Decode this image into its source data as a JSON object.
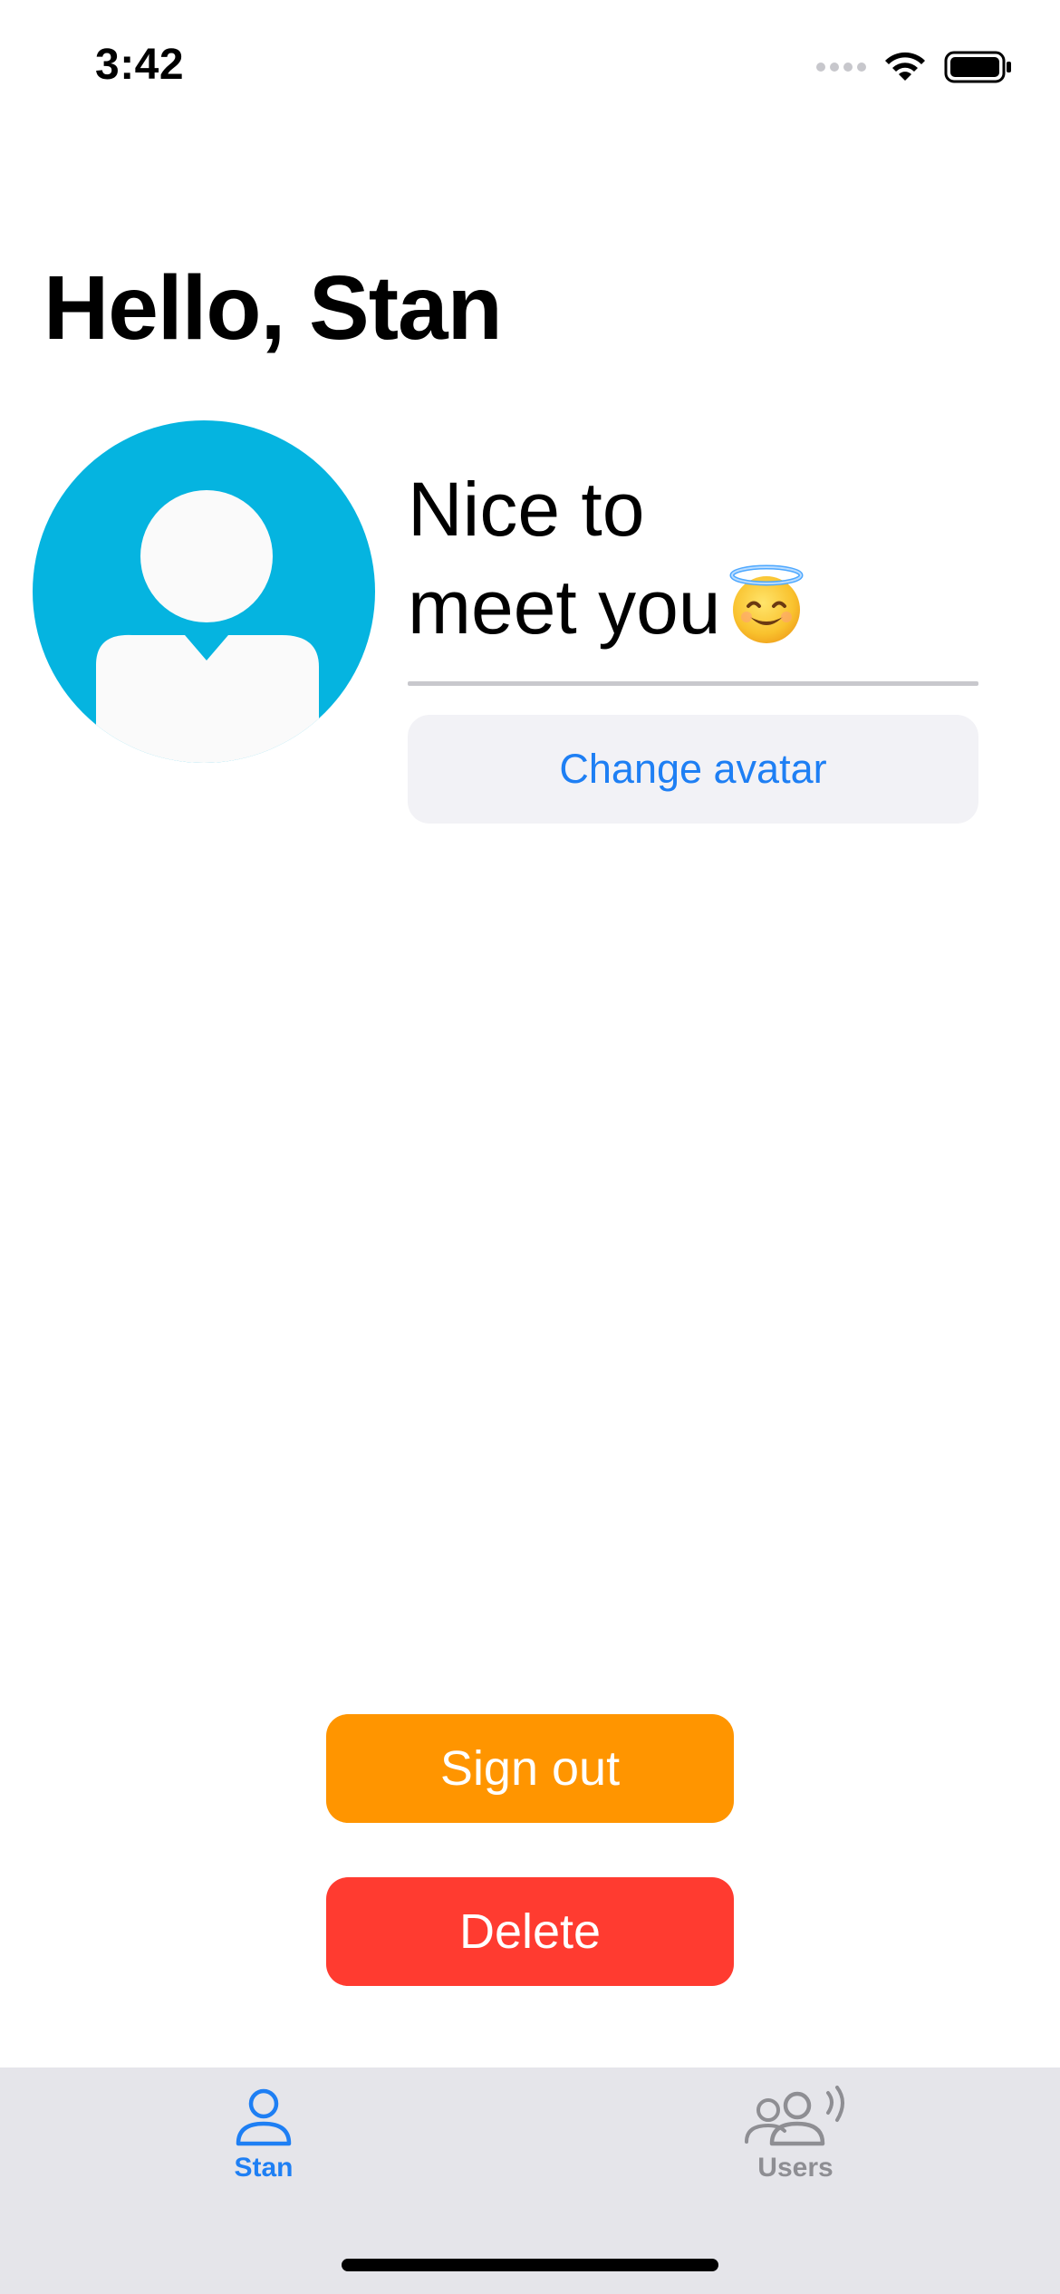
{
  "status_bar": {
    "time": "3:42",
    "icons": [
      "cellular-signal-icon",
      "wifi-icon",
      "battery-icon"
    ]
  },
  "header": {
    "title": "Hello, Stan"
  },
  "profile": {
    "avatar_color": "#05b4e0",
    "greeting_line1": "Nice to",
    "greeting_line2": "meet you",
    "greeting_emoji": "smiling-face-with-halo",
    "change_avatar_label": "Change avatar"
  },
  "actions": {
    "sign_out_label": "Sign out",
    "delete_label": "Delete"
  },
  "tab_bar": {
    "tabs": [
      {
        "label": "Stan",
        "icon": "person-icon",
        "selected": true
      },
      {
        "label": "Users",
        "icon": "users-wave-icon",
        "selected": false
      }
    ]
  },
  "colors": {
    "accent": "#1e7ff4",
    "sign_out": "#ff9500",
    "delete": "#ff3b30",
    "tab_bar_bg": "#e5e5ea"
  }
}
